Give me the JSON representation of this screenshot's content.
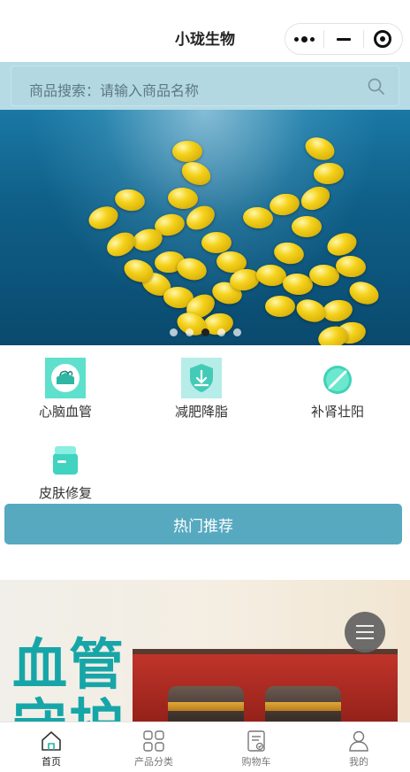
{
  "navbar": {
    "title": "小珑生物",
    "capsule": {
      "more_icon": "more-dots-icon",
      "minimize_icon": "minimize-icon",
      "close_icon": "target-circle-icon"
    }
  },
  "search": {
    "text": "商品搜索：请输入商品名称",
    "icon": "search-icon"
  },
  "banner": {
    "slide_count": 5,
    "active_index": 2
  },
  "categories": [
    {
      "label": "心脑血管",
      "icon": "heart-brain-icon"
    },
    {
      "label": "减肥降脂",
      "icon": "shield-down-icon"
    },
    {
      "label": "补肾壮阳",
      "icon": "pill-icon"
    },
    {
      "label": "皮肤修复",
      "icon": "cream-jar-icon"
    }
  ],
  "hot_button": {
    "label": "热门推荐"
  },
  "promo": {
    "title": "血管\n守护"
  },
  "tabbar": {
    "items": [
      {
        "label": "首页",
        "icon": "home-icon",
        "active": true
      },
      {
        "label": "产品分类",
        "icon": "grid-icon",
        "active": false
      },
      {
        "label": "购物车",
        "icon": "cart-icon",
        "active": false
      },
      {
        "label": "我的",
        "icon": "user-icon",
        "active": false
      }
    ]
  },
  "colors": {
    "accent": "#57a9c0",
    "search_bg": "#b6dbe5",
    "icon_teal": "#3fd3c0",
    "promo_title": "#17a6a8"
  }
}
